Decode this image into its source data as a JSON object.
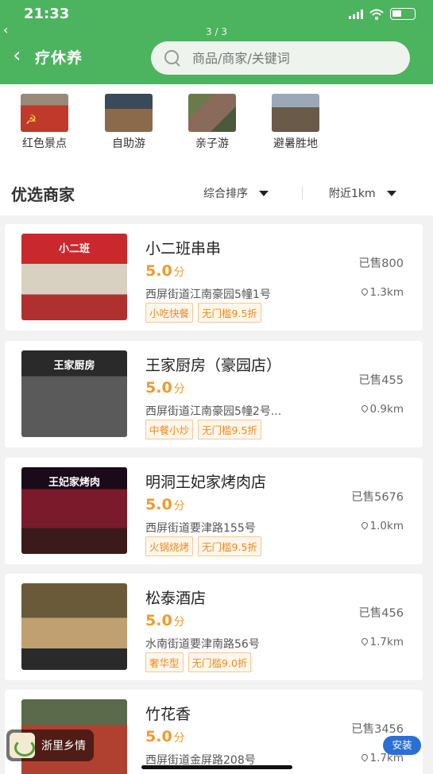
{
  "status_bar": {
    "time": "21:33"
  },
  "header": {
    "back_small": "‹",
    "page_indicator": "3 / 3",
    "back_icon": "‹",
    "title": "疗休养",
    "search_placeholder": "商品/商家/关键词"
  },
  "categories": [
    {
      "label": "红色景点",
      "icon": "red-flag-icon",
      "color": "#c0392b"
    },
    {
      "label": "自助游",
      "icon": "street-scene-icon",
      "color": "#5b4a3a"
    },
    {
      "label": "亲子游",
      "icon": "family-icon",
      "color": "#6b5a4a"
    },
    {
      "label": "避暑胜地",
      "icon": "mountain-icon",
      "color": "#7a6a5a"
    }
  ],
  "filter": {
    "section_title": "优选商家",
    "sort_label": "综合排序",
    "distance_label": "附近1km"
  },
  "shops": [
    {
      "name": "小二班串串",
      "rating": "5.0",
      "rating_unit": "分",
      "address": "西屏街道江南豪园5幢1号",
      "tags": [
        "小吃快餐",
        "无门槛9.5折"
      ],
      "sold": "已售800",
      "distance": "1.3km",
      "sign": "小二班",
      "sign_bg": "#c9282d"
    },
    {
      "name": "王家厨房（豪园店）",
      "rating": "5.0",
      "rating_unit": "分",
      "address": "西屏街道江南豪园5幢2号...",
      "tags": [
        "中餐小炒",
        "无门槛9.5折"
      ],
      "sold": "已售455",
      "distance": "0.9km",
      "sign": "王家厨房",
      "sign_bg": "#2a2a2a"
    },
    {
      "name": "明洞王妃家烤肉店",
      "rating": "5.0",
      "rating_unit": "分",
      "address": "西屏街道要津路155号",
      "tags": [
        "火锅烧烤",
        "无门槛9.5折"
      ],
      "sold": "已售5676",
      "distance": "1.0km",
      "sign": "王妃家烤肉",
      "sign_bg": "#1a0a1a"
    },
    {
      "name": "松泰酒店",
      "rating": "5.0",
      "rating_unit": "分",
      "address": "水南街道要津南路56号",
      "tags": [
        "奢华型",
        "无门槛9.0折"
      ],
      "sold": "已售456",
      "distance": "1.7km",
      "sign": "",
      "sign_bg": "#4a3a2a"
    },
    {
      "name": "竹花香",
      "rating": "5.0",
      "rating_unit": "分",
      "address": "西屏街道金屏路208号",
      "tags": [],
      "sold": "已售3456",
      "distance": "1.7km",
      "sign": "",
      "sign_bg": "#6a3a2a"
    }
  ],
  "app_banner": {
    "name": "浙里乡情",
    "install_label": "安装"
  }
}
